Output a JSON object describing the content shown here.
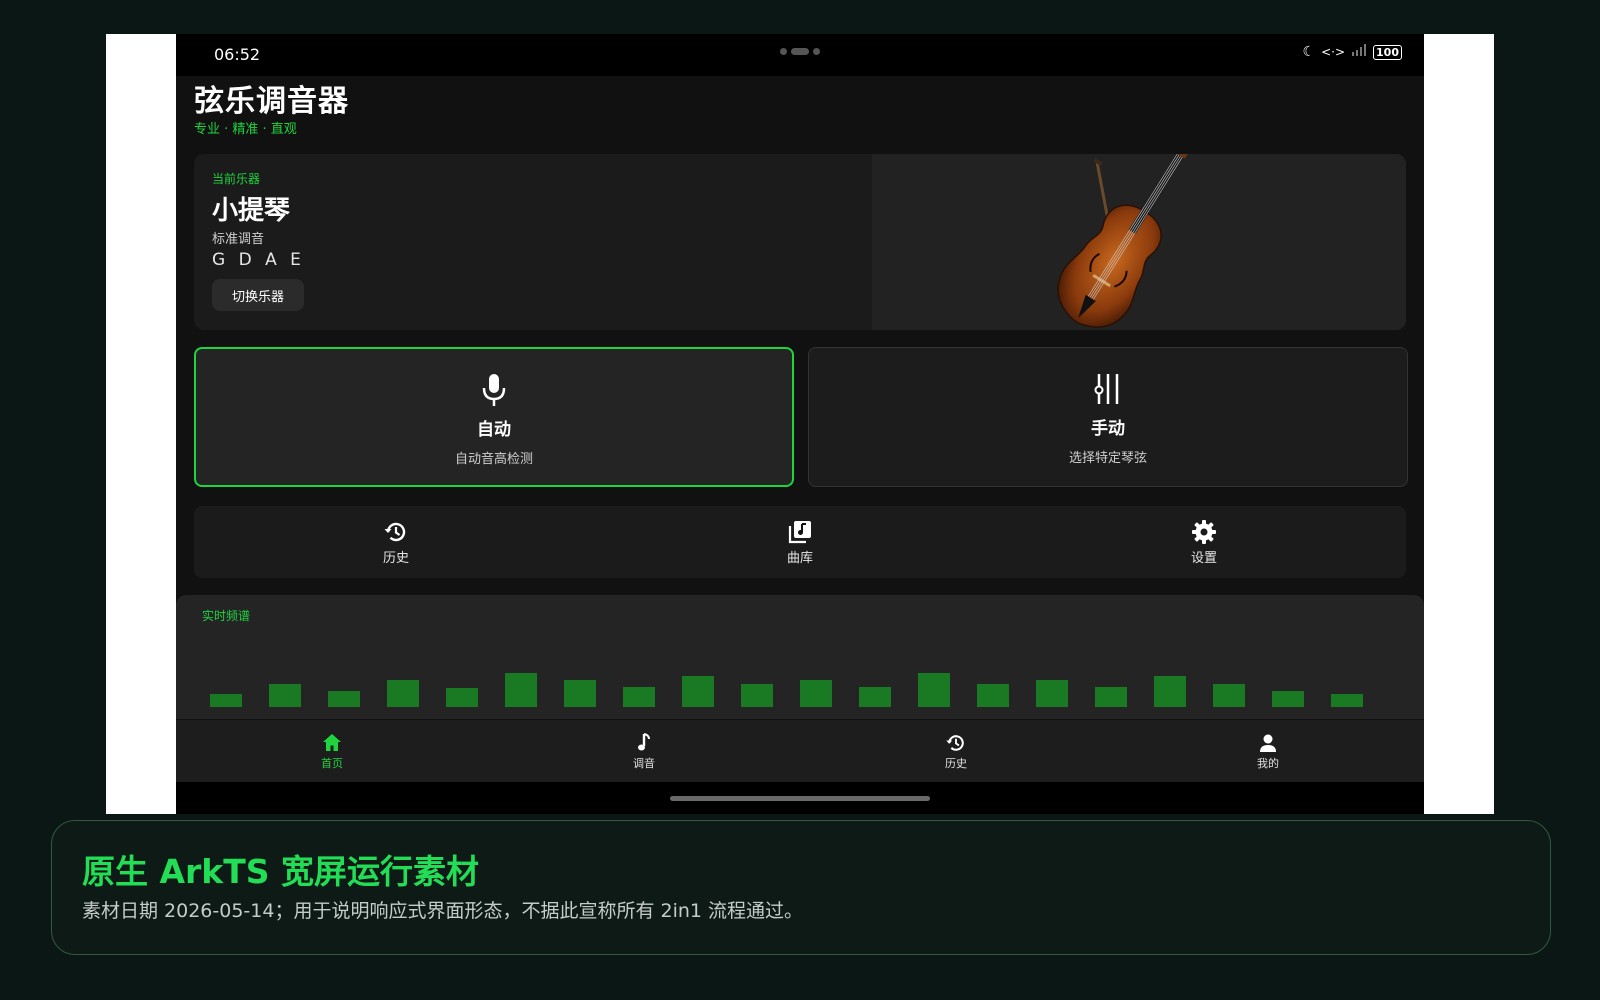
{
  "status_bar": {
    "time": "06:52",
    "battery": "100"
  },
  "app": {
    "title": "弦乐调音器",
    "subtitle": "专业 · 精准 · 直观"
  },
  "instrument": {
    "label": "当前乐器",
    "name": "小提琴",
    "tuning_label": "标准调音",
    "tuning_notes": "G D A E",
    "switch_label": "切换乐器",
    "image": "violin"
  },
  "modes": [
    {
      "title": "自动",
      "desc": "自动音高检测",
      "icon": "microphone-icon",
      "selected": true
    },
    {
      "title": "手动",
      "desc": "选择特定琴弦",
      "icon": "sliders-icon",
      "selected": false
    }
  ],
  "shortcuts": [
    {
      "label": "历史",
      "icon": "history-icon"
    },
    {
      "label": "曲库",
      "icon": "music-library-icon"
    },
    {
      "label": "设置",
      "icon": "gear-icon"
    }
  ],
  "spectrum": {
    "title": "实时频谱",
    "bar_color": "#1a7a23",
    "levels": [
      0.3,
      0.55,
      0.38,
      0.65,
      0.45,
      0.82,
      0.65,
      0.47,
      0.73,
      0.55,
      0.65,
      0.47,
      0.82,
      0.55,
      0.65,
      0.47,
      0.73,
      0.55,
      0.38,
      0.3
    ]
  },
  "bottom_nav": [
    {
      "label": "首页",
      "icon": "home-icon",
      "active": true
    },
    {
      "label": "调音",
      "icon": "music-note-icon",
      "active": false
    },
    {
      "label": "历史",
      "icon": "history-icon",
      "active": false
    },
    {
      "label": "我的",
      "icon": "person-icon",
      "active": false
    }
  ],
  "caption": {
    "title": "原生 ArkTS 宽屏运行素材",
    "text": "素材日期 2026-05-14；用于说明响应式界面形态，不据此宣称所有 2in1 流程通过。"
  },
  "colors": {
    "accent": "#1fd43f",
    "background": "#111111",
    "card": "#1b1b1b"
  }
}
